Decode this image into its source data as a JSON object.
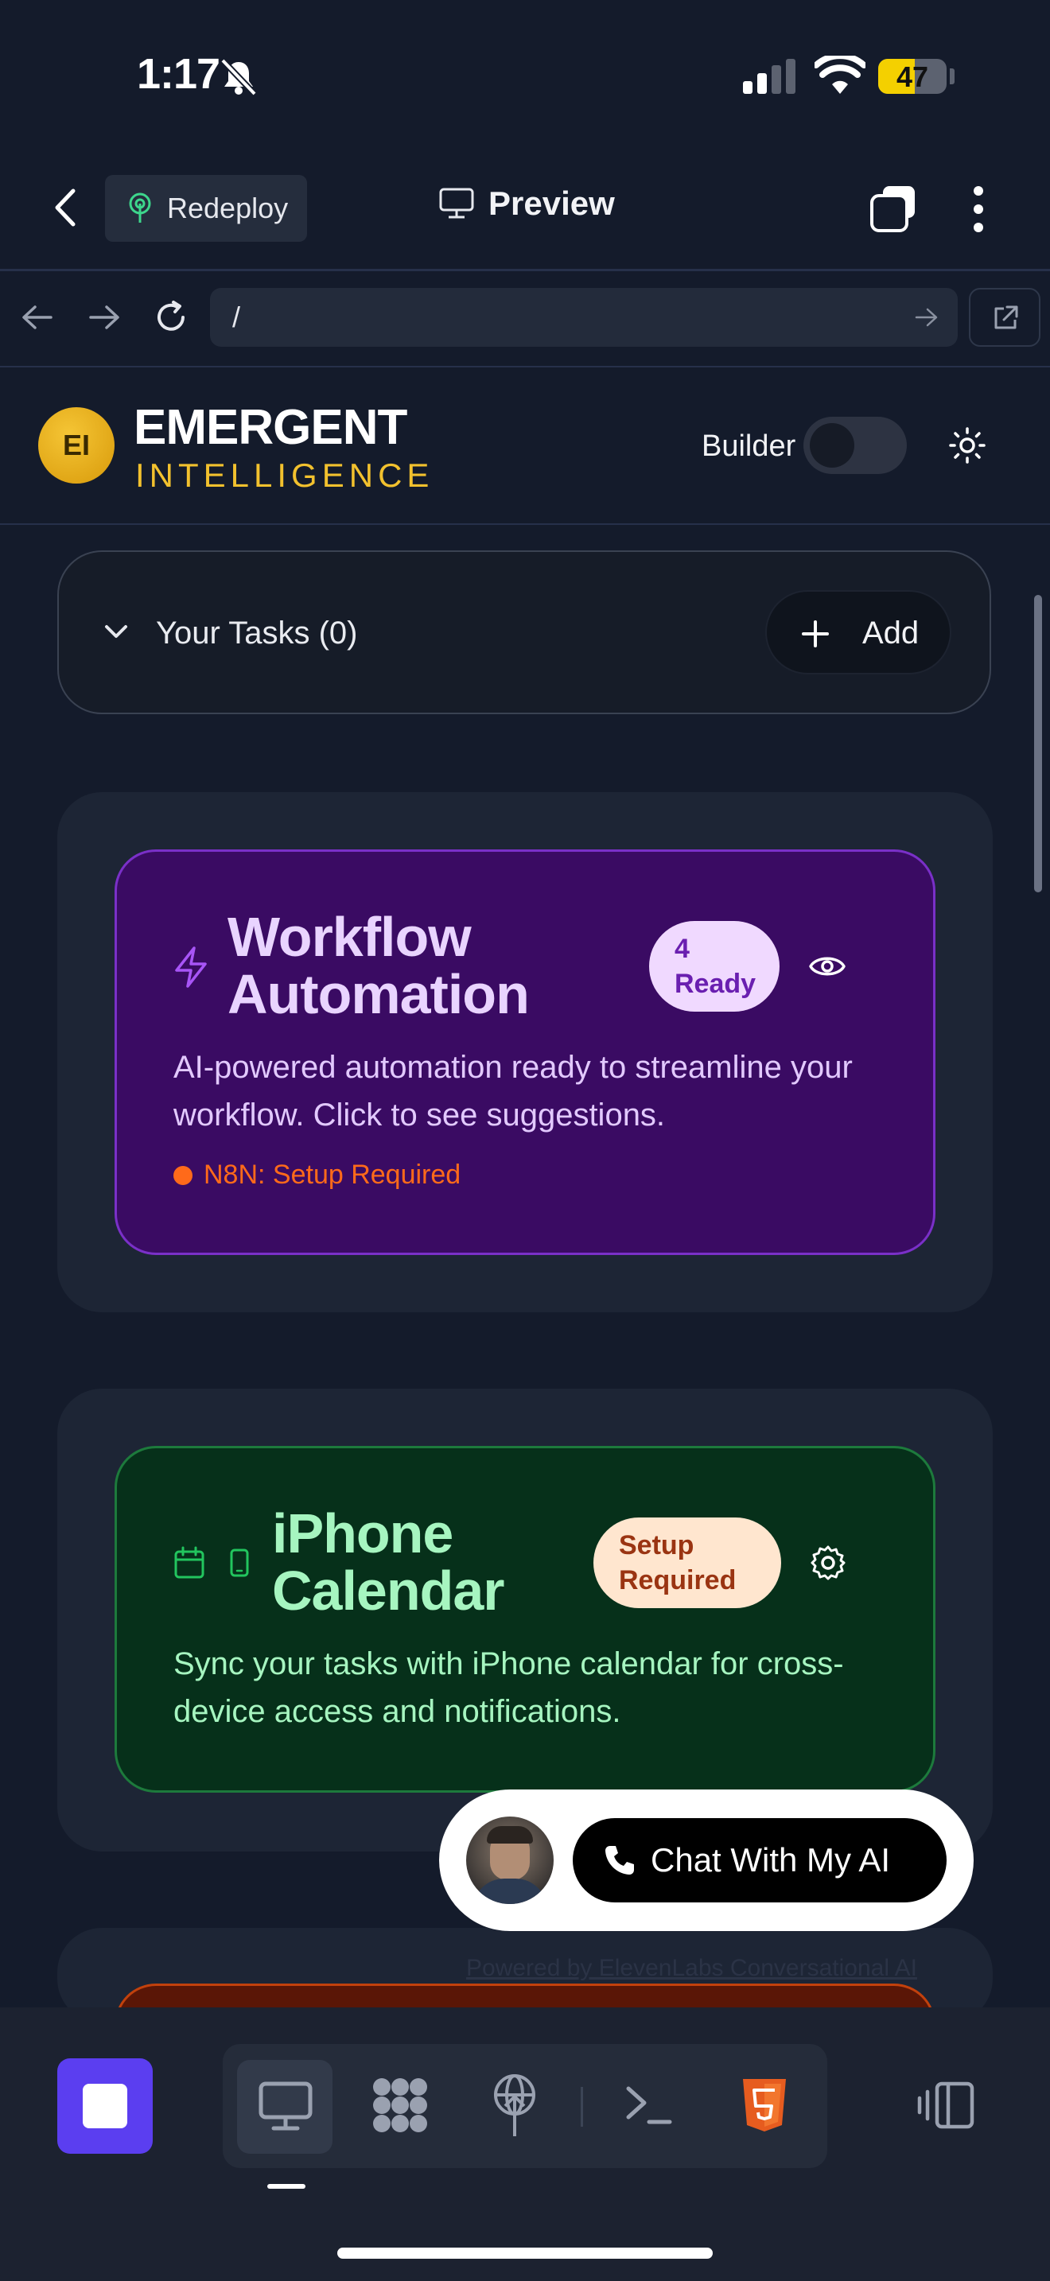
{
  "status_bar": {
    "time": "1:17",
    "battery": "47"
  },
  "top_nav": {
    "redeploy_label": "Redeploy",
    "title": "Preview"
  },
  "url_bar": {
    "path": "/"
  },
  "header": {
    "logo_initials": "EI",
    "brand_top": "EMERGENT",
    "brand_bottom": "INTELLIGENCE",
    "builder_label": "Builder",
    "builder_enabled": false
  },
  "tasks": {
    "title": "Your Tasks (0)",
    "add_label": "Add"
  },
  "workflow_card": {
    "title_line1": "Workflow",
    "title_line2": "Automation",
    "badge_line1": "4",
    "badge_line2": "Ready",
    "description": "AI-powered automation ready to streamline your workflow. Click to see suggestions.",
    "status": "N8N: Setup Required"
  },
  "calendar_card": {
    "title_line1": "iPhone",
    "title_line2": "Calendar",
    "badge_line1": "Setup",
    "badge_line2": "Required",
    "description": "Sync your tasks with iPhone calendar for cross-device access and notifications."
  },
  "chat_widget": {
    "button_label": "Chat With My AI",
    "powered_by": "Powered by ElevenLabs Conversational AI"
  },
  "colors": {
    "accent_purple": "#5b3ef0",
    "brand_gold": "#f2c12e",
    "workflow_bg": "#3a0b63",
    "calendar_bg": "#06301a",
    "n8n_orange": "#ff6a1a"
  },
  "icons": [
    "back-icon",
    "redeploy-icon",
    "monitor-icon",
    "tabs-icon",
    "more-icon",
    "nav-back-icon",
    "nav-forward-icon",
    "reload-icon",
    "go-icon",
    "open-external-icon",
    "sun-icon",
    "chevron-down-icon",
    "plus-icon",
    "bolt-icon",
    "eye-icon",
    "calendar-icon",
    "phone-icon",
    "gear-icon",
    "stop-icon",
    "desktop-icon",
    "apps-icon",
    "deploy-icon",
    "terminal-icon",
    "html5-icon",
    "panel-toggle-icon"
  ]
}
